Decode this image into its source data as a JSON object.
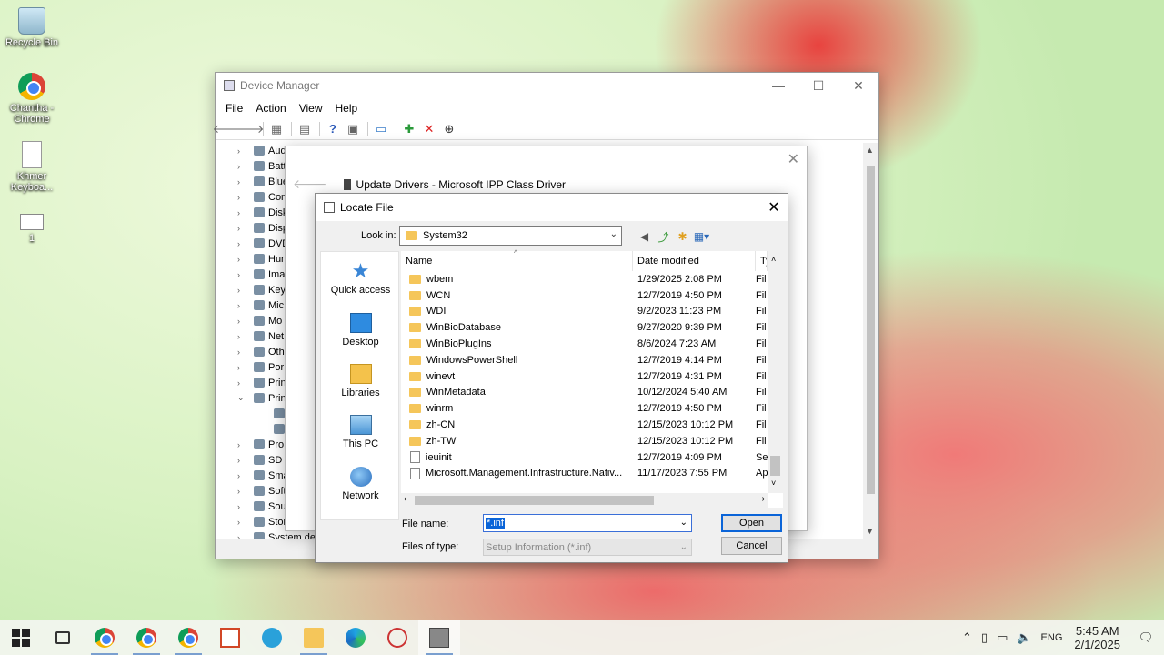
{
  "desktop": {
    "icons": [
      {
        "label": "Recycle Bin",
        "icon": "recycle-bin-icon"
      },
      {
        "label": "Chantha - Chrome",
        "icon": "chrome-icon"
      },
      {
        "label": "Khmer Keyboa...",
        "icon": "file-icon"
      },
      {
        "label": "1",
        "icon": "file-icon"
      }
    ]
  },
  "device_manager": {
    "title": "Device Manager",
    "menu": [
      "File",
      "Action",
      "View",
      "Help"
    ],
    "tree": [
      {
        "label": "Aud",
        "exp": "›"
      },
      {
        "label": "Batt",
        "exp": "›"
      },
      {
        "label": "Blue",
        "exp": "›"
      },
      {
        "label": "Con",
        "exp": "›"
      },
      {
        "label": "Disk",
        "exp": "›"
      },
      {
        "label": "Disp",
        "exp": "›"
      },
      {
        "label": "DVD",
        "exp": "›"
      },
      {
        "label": "Hun",
        "exp": "›"
      },
      {
        "label": "Ima",
        "exp": "›"
      },
      {
        "label": "Key",
        "exp": "›"
      },
      {
        "label": "Mic",
        "exp": "›"
      },
      {
        "label": "Mo",
        "exp": "›"
      },
      {
        "label": "Net",
        "exp": "›"
      },
      {
        "label": "Oth",
        "exp": "›"
      },
      {
        "label": "Por",
        "exp": "›"
      },
      {
        "label": "Prin",
        "exp": "›"
      },
      {
        "label": "Prin",
        "exp": "⌄"
      },
      {
        "label": "",
        "exp": ""
      },
      {
        "label": "",
        "exp": ""
      },
      {
        "label": "Pro",
        "exp": "›"
      },
      {
        "label": "SD I",
        "exp": "›"
      },
      {
        "label": "Sma",
        "exp": "›"
      },
      {
        "label": "Soft",
        "exp": "›"
      },
      {
        "label": "Sou",
        "exp": "›"
      },
      {
        "label": "Stor",
        "exp": "›"
      },
      {
        "label": "System de",
        "exp": "›"
      }
    ]
  },
  "update_drivers": {
    "title": "Update Drivers - Microsoft IPP Class Driver"
  },
  "locate_file": {
    "title": "Locate File",
    "look_in_label": "Look in:",
    "look_in_value": "System32",
    "places": [
      "Quick access",
      "Desktop",
      "Libraries",
      "This PC",
      "Network"
    ],
    "columns": {
      "name": "Name",
      "date": "Date modified",
      "type": "Ty"
    },
    "files": [
      {
        "name": "wbem",
        "date": "1/29/2025 2:08 PM",
        "type": "Fil",
        "kind": "folder"
      },
      {
        "name": "WCN",
        "date": "12/7/2019 4:50 PM",
        "type": "Fil",
        "kind": "folder"
      },
      {
        "name": "WDI",
        "date": "9/2/2023 11:23 PM",
        "type": "Fil",
        "kind": "folder"
      },
      {
        "name": "WinBioDatabase",
        "date": "9/27/2020 9:39 PM",
        "type": "Fil",
        "kind": "folder"
      },
      {
        "name": "WinBioPlugIns",
        "date": "8/6/2024 7:23 AM",
        "type": "Fil",
        "kind": "folder"
      },
      {
        "name": "WindowsPowerShell",
        "date": "12/7/2019 4:14 PM",
        "type": "Fil",
        "kind": "folder"
      },
      {
        "name": "winevt",
        "date": "12/7/2019 4:31 PM",
        "type": "Fil",
        "kind": "folder"
      },
      {
        "name": "WinMetadata",
        "date": "10/12/2024 5:40 AM",
        "type": "Fil",
        "kind": "folder"
      },
      {
        "name": "winrm",
        "date": "12/7/2019 4:50 PM",
        "type": "Fil",
        "kind": "folder"
      },
      {
        "name": "zh-CN",
        "date": "12/15/2023 10:12 PM",
        "type": "Fil",
        "kind": "folder"
      },
      {
        "name": "zh-TW",
        "date": "12/15/2023 10:12 PM",
        "type": "Fil",
        "kind": "folder"
      },
      {
        "name": "ieuinit",
        "date": "12/7/2019 4:09 PM",
        "type": "Se",
        "kind": "file"
      },
      {
        "name": "Microsoft.Management.Infrastructure.Nativ...",
        "date": "11/17/2023 7:55 PM",
        "type": "Ap",
        "kind": "file"
      }
    ],
    "file_name_label": "File name:",
    "file_name_value": "*.inf",
    "file_type_label": "Files of type:",
    "file_type_value": "Setup Information (*.inf)",
    "open_label": "Open",
    "cancel_label": "Cancel"
  },
  "taskbar": {
    "language": "ENG",
    "time": "5:45 AM",
    "date": "2/1/2025"
  }
}
